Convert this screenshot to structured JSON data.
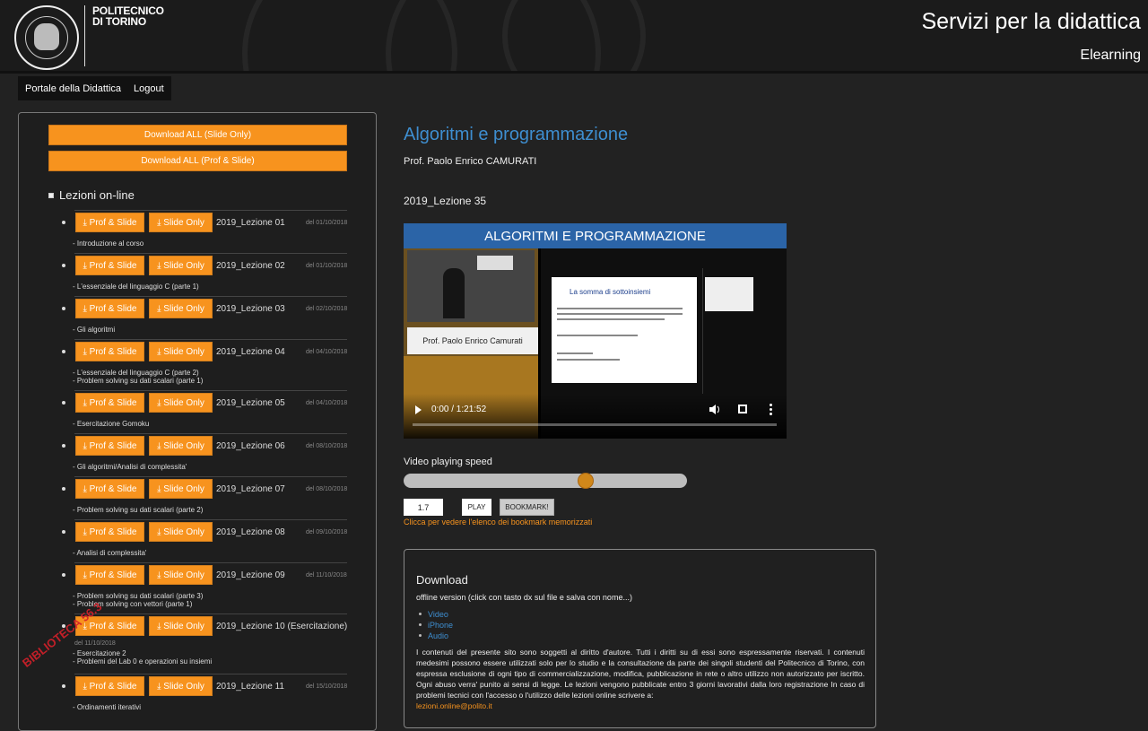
{
  "header": {
    "logo_line1": "POLITECNICO",
    "logo_line2": "DI TORINO",
    "title": "Servizi per la didattica",
    "subtitle": "Elearning"
  },
  "nav": {
    "items": [
      "Portale della Didattica",
      "Logout"
    ]
  },
  "left": {
    "download_all_slide": "Download ALL (Slide Only)",
    "download_all_prof": "Download ALL (Prof & Slide)",
    "section_title": "Lezioni on-line",
    "btn_prof": "Prof & Slide",
    "btn_slide": "Slide Only",
    "lessons": [
      {
        "name": "2019_Lezione 01",
        "date": "del 01/10/2018",
        "desc": [
          "- Introduzione al corso"
        ]
      },
      {
        "name": "2019_Lezione 02",
        "date": "del 01/10/2018",
        "desc": [
          "- L'essenziale del linguaggio C (parte 1)"
        ]
      },
      {
        "name": "2019_Lezione 03",
        "date": "del 02/10/2018",
        "desc": [
          "- Gli algoritmi"
        ]
      },
      {
        "name": "2019_Lezione 04",
        "date": "del 04/10/2018",
        "desc": [
          "- L'essenziale del linguaggio C (parte 2)",
          "- Problem solving su dati scalari (parte 1)"
        ]
      },
      {
        "name": "2019_Lezione 05",
        "date": "del 04/10/2018",
        "desc": [
          "- Esercitazione Gomoku"
        ]
      },
      {
        "name": "2019_Lezione 06",
        "date": "del 08/10/2018",
        "desc": [
          "- Gli algoritmi/Analisi di complessita'"
        ]
      },
      {
        "name": "2019_Lezione 07",
        "date": "del 08/10/2018",
        "desc": [
          "- Problem solving su dati scalari (parte 2)"
        ]
      },
      {
        "name": "2019_Lezione 08",
        "date": "del 09/10/2018",
        "desc": [
          "- Analisi di complessita'"
        ]
      },
      {
        "name": "2019_Lezione 09",
        "date": "del 11/10/2018",
        "desc": [
          "- Problem solving su dati scalari (parte 3)",
          "- Problem solving con vettori (parte 1)"
        ]
      },
      {
        "name": "2019_Lezione 10 (Esercitazione)",
        "date": "del 11/10/2018",
        "desc": [
          "- Esercitazione 2",
          "- Problemi del Lab 0 e operazioni su insiemi"
        ]
      },
      {
        "name": "2019_Lezione 11",
        "date": "del 15/10/2018",
        "desc": [
          "- Ordinamenti iterativi"
        ]
      }
    ]
  },
  "main": {
    "course_title": "Algoritmi e programmazione",
    "professor": "Prof. Paolo Enrico CAMURATI",
    "lesson_title": "2019_Lezione 35",
    "video": {
      "banner": "ALGORITMI E PROGRAMMAZIONE",
      "prof_plate": "Prof. Paolo Enrico Camurati",
      "slide_title": "La somma di sottoinsiemi",
      "time": "0:00 / 1:21:52"
    },
    "speed_label": "Video playing speed",
    "speed_fraction": 0.65,
    "speed_value": "1.7",
    "play_label": "PLAY",
    "bookmark_label": "BOOKMARK!",
    "bookmark_link": "Clicca per vedere l'elenco dei bookmark memorizzati",
    "download": {
      "title": "Download",
      "subtitle": "offline version (click con tasto dx sul file e salva con nome...)",
      "links": [
        "Video",
        "iPhone",
        "Audio"
      ],
      "legal": "I contenuti del presente sito sono soggetti al diritto d'autore. Tutti i diritti su di essi sono espressamente riservati. I contenuti medesimi possono essere utilizzati solo per lo studio e la consultazione da parte dei singoli studenti del Politecnico di Torino, con espressa esclusione di ogni tipo di commercializzazione, modifica, pubblicazione in rete o altro utilizzo non autorizzato per iscritto. Ogni abuso verra' punito ai sensi di legge. Le lezioni vengono pubblicate entro 3 giorni lavorativi dalla loro registrazione In caso di problemi tecnici con l'accesso o l'utilizzo delle lezioni online scrivere a:",
      "email": "lezioni.online@polito.it"
    }
  },
  "watermark": "BIBLIOTECA 56.3",
  "colors": {
    "accent": "#f7931e",
    "link": "#3e8ed0",
    "background": "#222222"
  }
}
